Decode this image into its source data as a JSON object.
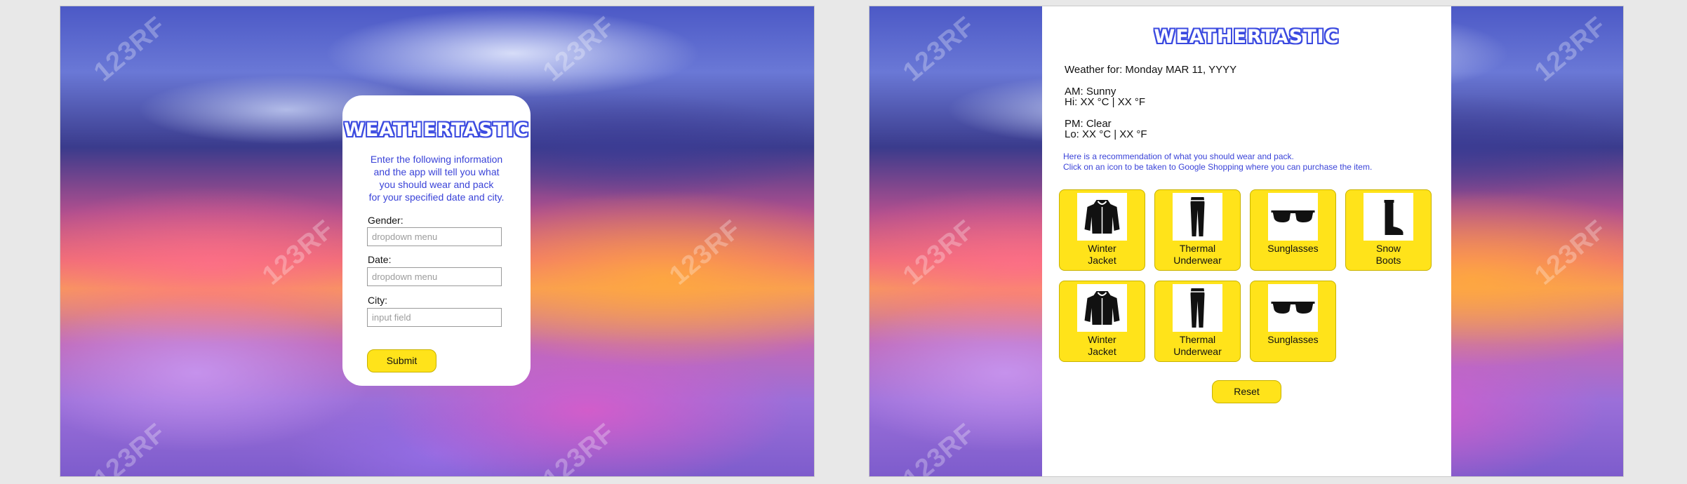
{
  "brand": {
    "logo": "WEATHERTASTIC",
    "watermark": "123RF"
  },
  "form": {
    "intro": [
      "Enter the following information",
      "and the app will tell you what",
      "you should wear and pack",
      "for your specified date and city."
    ],
    "gender": {
      "label": "Gender:",
      "placeholder": "dropdown menu"
    },
    "date": {
      "label": "Date:",
      "placeholder": "dropdown menu"
    },
    "city": {
      "label": "City:",
      "placeholder": "input field"
    },
    "submit_label": "Submit"
  },
  "result": {
    "weather_for": "Weather for: Monday MAR 11, YYYY",
    "am": "AM: Sunny",
    "hi": "Hi: XX °C | XX °F",
    "pm": "PM: Clear",
    "lo": "Lo: XX °C | XX °F",
    "note_1": "Here is a recommendation of what you should wear and pack.",
    "note_2": "Click on an icon to be taken to Google Shopping where you can purchase the item.",
    "items": [
      {
        "line1": "Winter",
        "line2": "Jacket",
        "icon": "jacket-icon"
      },
      {
        "line1": "Thermal",
        "line2": "Underwear",
        "icon": "thermal-underwear-icon"
      },
      {
        "line1": "Sunglasses",
        "line2": "",
        "icon": "sunglasses-icon"
      },
      {
        "line1": "Snow",
        "line2": "Boots",
        "icon": "snow-boots-icon"
      },
      {
        "line1": "Winter",
        "line2": "Jacket",
        "icon": "jacket-icon"
      },
      {
        "line1": "Thermal",
        "line2": "Underwear",
        "icon": "thermal-underwear-icon"
      },
      {
        "line1": "Sunglasses",
        "line2": "",
        "icon": "sunglasses-icon"
      }
    ],
    "reset_label": "Reset"
  },
  "colors": {
    "accent_blue": "#3a43d8",
    "button_yellow": "#ffe31a"
  }
}
